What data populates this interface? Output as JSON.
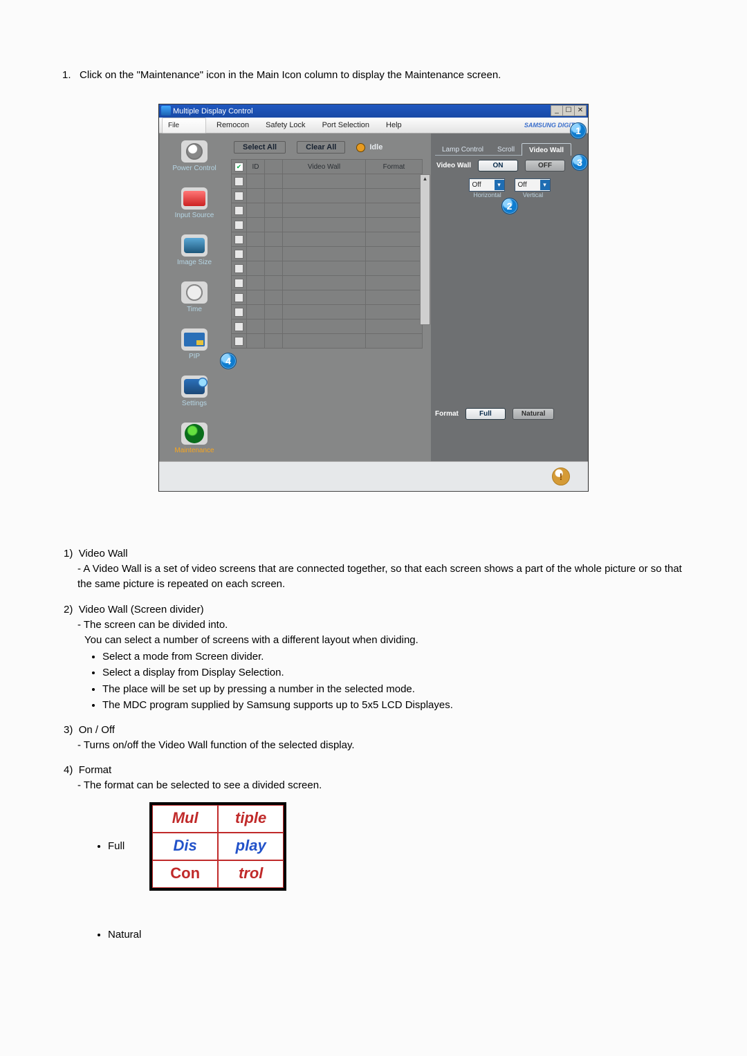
{
  "heading_prefix": "1.",
  "heading_text": "Click on the \"Maintenance\" icon in the Main Icon column to display the Maintenance screen.",
  "dialog": {
    "title": "Multiple Display Control",
    "menu": [
      "File",
      "Remocon",
      "Safety Lock",
      "Port Selection",
      "Help"
    ],
    "brand": "SAMSUNG DIGITall",
    "sidebar": [
      {
        "label": "Power Control"
      },
      {
        "label": "Input Source"
      },
      {
        "label": "Image Size"
      },
      {
        "label": "Time"
      },
      {
        "label": "PIP"
      },
      {
        "label": "Settings"
      },
      {
        "label": "Maintenance",
        "active": true
      }
    ],
    "top_actions": {
      "select_all": "Select All",
      "clear_all": "Clear All",
      "idle": "Idle"
    },
    "grid": {
      "columns": [
        "",
        "ID",
        "",
        "Video Wall",
        "Format"
      ],
      "row_count": 12
    },
    "panel": {
      "tabs": [
        "Lamp Control",
        "Scroll",
        "Video Wall"
      ],
      "active_tab": 2,
      "vw_label": "Video Wall",
      "on": "ON",
      "off": "OFF",
      "divider": {
        "horizontal_value": "Off",
        "horizontal_label": "Horizontal",
        "vertical_value": "Off",
        "vertical_label": "Vertical"
      },
      "format": {
        "label": "Format",
        "full": "Full",
        "natural": "Natural"
      }
    },
    "callouts": {
      "c1": "1",
      "c2": "2",
      "c3": "3",
      "c4": "4"
    }
  },
  "items": {
    "i1": {
      "num": "1)",
      "title": "Video Wall",
      "line1": "- A Video Wall is a set of video screens that are connected together, so that each screen shows a part of the whole picture or so that the same picture is repeated on each screen."
    },
    "i2": {
      "num": "2)",
      "title": "Video Wall (Screen divider)",
      "line1": "- The screen can be divided into.",
      "line2": "You can select a number of screens with a different layout when dividing.",
      "b1": "Select a mode from Screen divider.",
      "b2": "Select a display from Display Selection.",
      "b3": "The place will be set up by pressing a number in the selected mode.",
      "b4": "The MDC program supplied by Samsung supports up to 5x5 LCD Displayes."
    },
    "i3": {
      "num": "3)",
      "title": "On / Off",
      "line1": "- Turns on/off the Video Wall function of the selected display."
    },
    "i4": {
      "num": "4)",
      "title": "Format",
      "line1": "- The format can be selected to see a divided screen.",
      "full_label": "Full",
      "natural_label": "Natural",
      "full_words": [
        "Mul",
        "tiple",
        "Dis",
        "play",
        "Con",
        "trol"
      ]
    }
  }
}
